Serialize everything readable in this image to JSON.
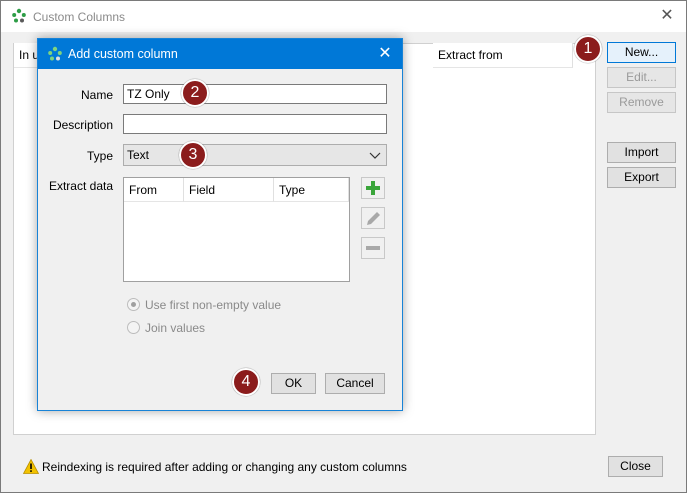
{
  "outer": {
    "title": "Custom Columns",
    "columns": [
      "In u",
      "Extract from"
    ],
    "buttons": {
      "new": "New...",
      "edit": "Edit...",
      "remove": "Remove",
      "import": "Import",
      "export": "Export",
      "close": "Close"
    },
    "status": "Reindexing is required after adding or changing any custom columns"
  },
  "dialog": {
    "title": "Add custom column",
    "labels": {
      "name": "Name",
      "description": "Description",
      "type": "Type",
      "extract": "Extract data"
    },
    "name_value": "TZ Only",
    "description_value": "",
    "type_value": "Text",
    "extract_columns": [
      "From",
      "Field",
      "Type"
    ],
    "radio_first": "Use first non-empty value",
    "radio_join": "Join values",
    "ok": "OK",
    "cancel": "Cancel"
  },
  "markers": [
    "1",
    "2",
    "3",
    "4"
  ],
  "colors": {
    "accent": "#0078d7",
    "marker": "#8b1c1c",
    "add": "#3aa53a"
  }
}
